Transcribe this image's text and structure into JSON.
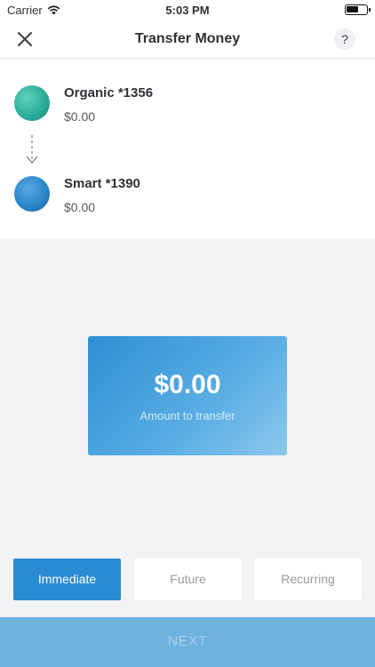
{
  "status_bar": {
    "carrier": "Carrier",
    "time": "5:03 PM",
    "battery_level_percent": 60
  },
  "nav": {
    "title": "Transfer Money",
    "help_label": "?"
  },
  "from_account": {
    "name": "Organic *1356",
    "balance": "$0.00"
  },
  "to_account": {
    "name": "Smart *1390",
    "balance": "$0.00"
  },
  "amount": {
    "value": "$0.00",
    "caption": "Amount to transfer"
  },
  "schedule": {
    "options": [
      "Immediate",
      "Future",
      "Recurring"
    ],
    "selected": "Immediate"
  },
  "next_button": {
    "label": "NEXT",
    "enabled": false
  },
  "colors": {
    "accent": "#2a8ad2",
    "card_gradient_start": "#2e8fd3",
    "next_bg": "#6eb3de"
  }
}
